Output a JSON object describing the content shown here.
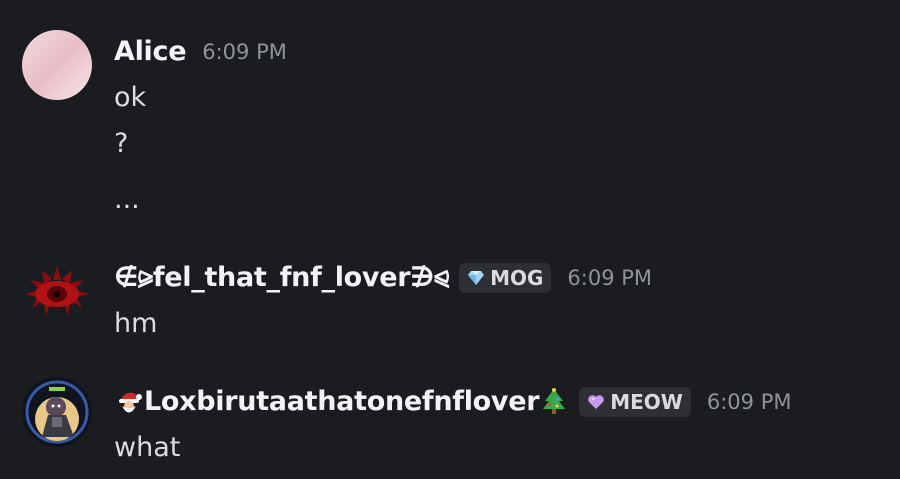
{
  "messages": [
    {
      "username": "Alice",
      "timestamp": "6:09 PM",
      "avatar": "pink-gradient-avatar",
      "lines": [
        "ok",
        "?",
        "..."
      ]
    },
    {
      "username": "∉⪩fel_that_fnf_lover∌⪨",
      "tag": {
        "label": "MOG",
        "icon": "diamond-icon"
      },
      "timestamp": "6:09 PM",
      "avatar": "red-eye-avatar",
      "lines": [
        "hm"
      ]
    },
    {
      "username": "Loxbirutaathatonefnflover",
      "prefix_icon": "santa-icon",
      "suffix_icon": "christmas-tree-icon",
      "tag": {
        "label": "MEOW",
        "icon": "purple-heart-icon"
      },
      "timestamp": "6:09 PM",
      "avatar": "character-avatar",
      "lines": [
        "what"
      ]
    }
  ],
  "colors": {
    "background": "#1b1c20",
    "username": "#f2f3f5",
    "message": "#dcdde1",
    "timestamp": "#8f939c",
    "tag_background": "#2e2f35"
  }
}
